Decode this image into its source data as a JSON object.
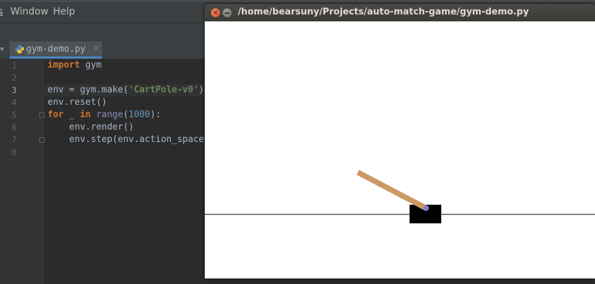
{
  "ide": {
    "menu": {
      "partial_label": "s",
      "window_label": "Window",
      "help_label": "Help"
    },
    "tab": {
      "arrow": "▾",
      "label": "gym-demo.py",
      "close": "×"
    },
    "line_numbers": [
      "1",
      "2",
      "3",
      "4",
      "5",
      "6",
      "7",
      "8"
    ],
    "code": {
      "line1_kw": "import",
      "line1_rest": " gym",
      "line3_a": "env = gym.make(",
      "line3_str": "'CartPole-v0'",
      "line3_b": ")",
      "line4": "env.reset()",
      "line5_kw1": "for",
      "line5_a": " _ ",
      "line5_kw2": "in",
      "line5_sp": " ",
      "line5_bi": "range",
      "line5_b": "(",
      "line5_num": "1000",
      "line5_c": "):",
      "line6": "    env.render()",
      "line7": "    env.step(env.action_space.sample())"
    }
  },
  "gym_window": {
    "title": "/home/bearsuny/Projects/auto-match-game/gym-demo.py",
    "close_glyph": "×",
    "colors": {
      "pole": "#cc9966",
      "cart": "#000000",
      "axle": "#8080cc",
      "track": "#000000"
    }
  }
}
